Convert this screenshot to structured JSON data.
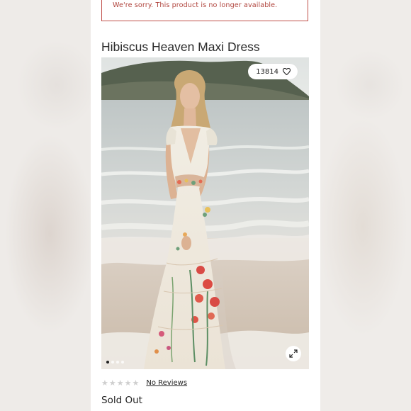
{
  "alert": {
    "message": "We're sorry. This product is no longer available."
  },
  "product": {
    "title": "Hibiscus Heaven Maxi Dress",
    "likes_count": "13814",
    "rating_stars": 0,
    "reviews_link": "No Reviews",
    "availability": "Sold Out"
  },
  "gallery": {
    "total_images": 4,
    "active_index": 0
  },
  "icons": {
    "like": "heart-icon",
    "expand": "expand-icon",
    "star": "star-icon"
  },
  "colors": {
    "alert_border": "#c0504a",
    "alert_text": "#b0443d",
    "text": "#222222",
    "star_empty": "#cfcfcf"
  }
}
